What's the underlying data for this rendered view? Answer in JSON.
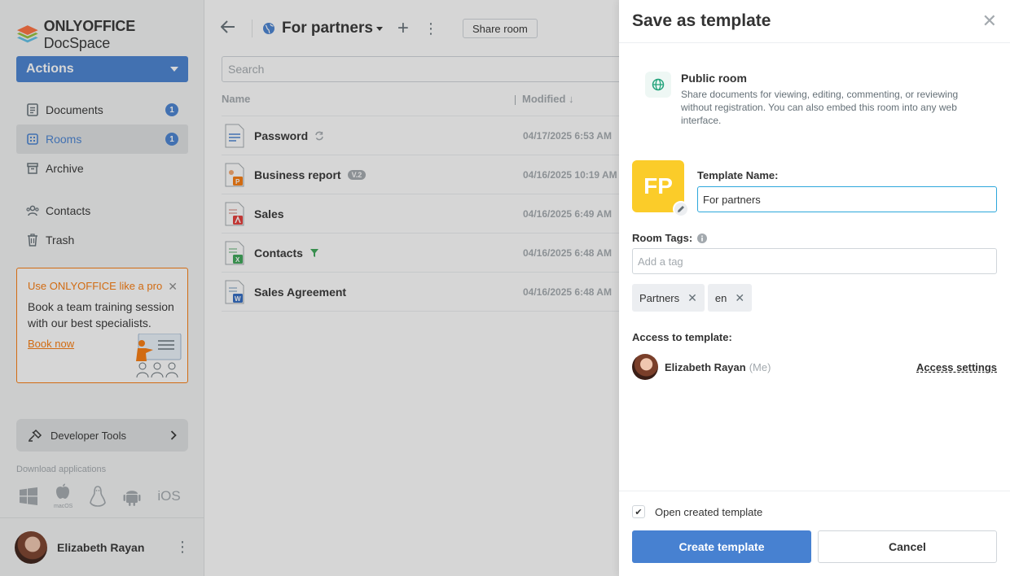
{
  "brand": {
    "name_bold": "ONLYOFFICE",
    "name_rest": " DocSpace"
  },
  "sidebar": {
    "actions_label": "Actions",
    "items": [
      {
        "label": "Documents",
        "badge": "1",
        "icon": "document-icon"
      },
      {
        "label": "Rooms",
        "badge": "1",
        "icon": "rooms-icon",
        "active": true
      },
      {
        "label": "Archive",
        "icon": "archive-icon"
      },
      {
        "label": "Contacts",
        "icon": "contacts-icon"
      },
      {
        "label": "Trash",
        "icon": "trash-icon"
      }
    ],
    "promo": {
      "heading": "Use ONLYOFFICE like a pro",
      "body": "Book a team training session with our best specialists.",
      "link": "Book now"
    },
    "developer_tools": "Developer Tools",
    "download_label": "Download applications",
    "download_apps": {
      "macos_label": "macOS",
      "ios_label": "iOS"
    },
    "user": {
      "name": "Elizabeth Rayan"
    }
  },
  "main": {
    "room_title": "For partners",
    "share_label": "Share room",
    "search_placeholder": "Search",
    "columns": {
      "name": "Name",
      "modified": "Modified ↓"
    },
    "files": [
      {
        "name": "Password",
        "modified": "04/17/2025 6:53 AM",
        "type": "txt",
        "extra": "sync-icon"
      },
      {
        "name": "Business report",
        "modified": "04/16/2025 10:19 AM",
        "type": "pptx",
        "extra": "V.2"
      },
      {
        "name": "Sales",
        "modified": "04/16/2025 6:49 AM",
        "type": "pdf"
      },
      {
        "name": "Contacts",
        "modified": "04/16/2025 6:48 AM",
        "type": "xlsx",
        "extra": "filter-icon"
      },
      {
        "name": "Sales Agreement",
        "modified": "04/16/2025 6:48 AM",
        "type": "docx"
      }
    ]
  },
  "panel": {
    "title": "Save as template",
    "room_type": {
      "title": "Public room",
      "description": "Share documents for viewing, editing, commenting, or reviewing without registration. You can also embed this room into any web interface."
    },
    "logo_initials": "FP",
    "logo_color": "#fbcc29",
    "template_name_label": "Template Name:",
    "template_name_value": "For partners",
    "room_tags_label": "Room Tags:",
    "tag_placeholder": "Add a tag",
    "tags": [
      "Partners",
      "en"
    ],
    "access_label": "Access to template:",
    "access_user": {
      "name": "Elizabeth Rayan",
      "me": "(Me)"
    },
    "access_settings": "Access settings",
    "open_created_label": "Open created template",
    "open_created_checked": true,
    "create_button": "Create template",
    "cancel_button": "Cancel"
  },
  "colors": {
    "accent": "#4781d1",
    "promo": "#f97a0b",
    "overlay": "rgba(51,51,51,0.2)"
  }
}
